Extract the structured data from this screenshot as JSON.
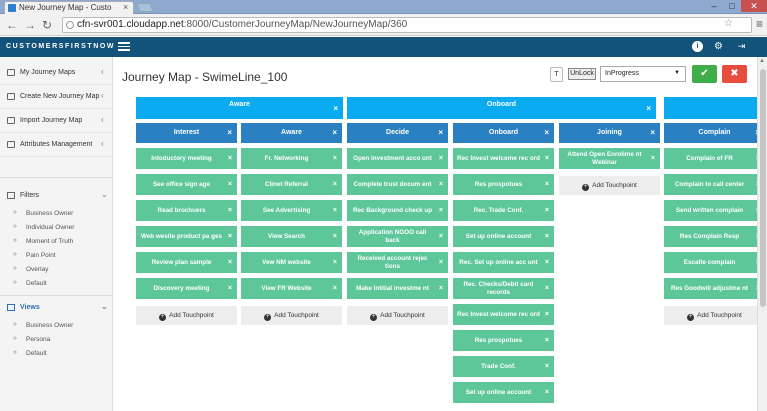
{
  "browser": {
    "tab_title": "New Journey Map - Custo",
    "url_host": "cfn-svr001.cloudapp.net",
    "url_path": ":8000/CustomerJourneyMap/NewJourneyMap/360"
  },
  "app": {
    "brand": "CUSTOMERSFIRSTNOW"
  },
  "sidebar": {
    "items": [
      {
        "label": "My Journey Maps"
      },
      {
        "label": "Create New Journey Map"
      },
      {
        "label": "Import Journey Map"
      },
      {
        "label": "Attributes Management"
      }
    ],
    "filters_label": "Filters",
    "filters": [
      "Business Owner",
      "Individual Owner",
      "Moment of Truth",
      "Pain Point",
      "Overlay",
      "Default"
    ],
    "views_label": "Views",
    "views": [
      "Business Owner",
      "Persona",
      "Default"
    ]
  },
  "main": {
    "title": "Journey Map - SwimeLine_100",
    "t_label": "T",
    "unlock_label": "UnLock",
    "status_value": "InProgress",
    "add_touchpoint": "Add Touchpoint"
  },
  "stages": [
    {
      "label": "Aware"
    },
    {
      "label": "Onboard"
    },
    {
      "label": ""
    }
  ],
  "columns": [
    {
      "label": "Interest",
      "cards": [
        "Intoductory meeting",
        "See office sign age",
        "Read brochuers",
        "Web wesite product pa ges",
        "Review plan sample",
        "Discovery meeting"
      ]
    },
    {
      "label": "Aware",
      "cards": [
        "Fr. Networking",
        "Clinet Referral",
        "See Advertising",
        "View Search",
        "Vew NM website",
        "View FR Website"
      ]
    },
    {
      "label": "Decide",
      "cards": [
        "Open investment acco unt",
        "Complete trust docum ent",
        "Rec Background check up",
        "Application NGOO call back",
        "Received account rejec tions",
        "Make Intitial investme nt"
      ]
    },
    {
      "label": "Onboard",
      "cards": [
        "Rec Invest welcome rec ord",
        "Res prospotues",
        "Rec. Trade Conf.",
        "Set up online account",
        "Rec. Set up online acc unt",
        "Rec. Checks/Debit card records",
        "Rec Invest welcome rec ord",
        "Res prospotues",
        "Trade Conf.",
        "Set up online account"
      ]
    },
    {
      "label": "Joining",
      "cards": [
        "Attend Open Enrolime nt Webinar"
      ]
    },
    {
      "label": "Complain",
      "cards": [
        "Complain of FR",
        "Complain to call center",
        "Send written complain",
        "Res Complain Resp",
        "Escalte complain",
        "Res Goodwill adjustme nt"
      ]
    }
  ]
}
